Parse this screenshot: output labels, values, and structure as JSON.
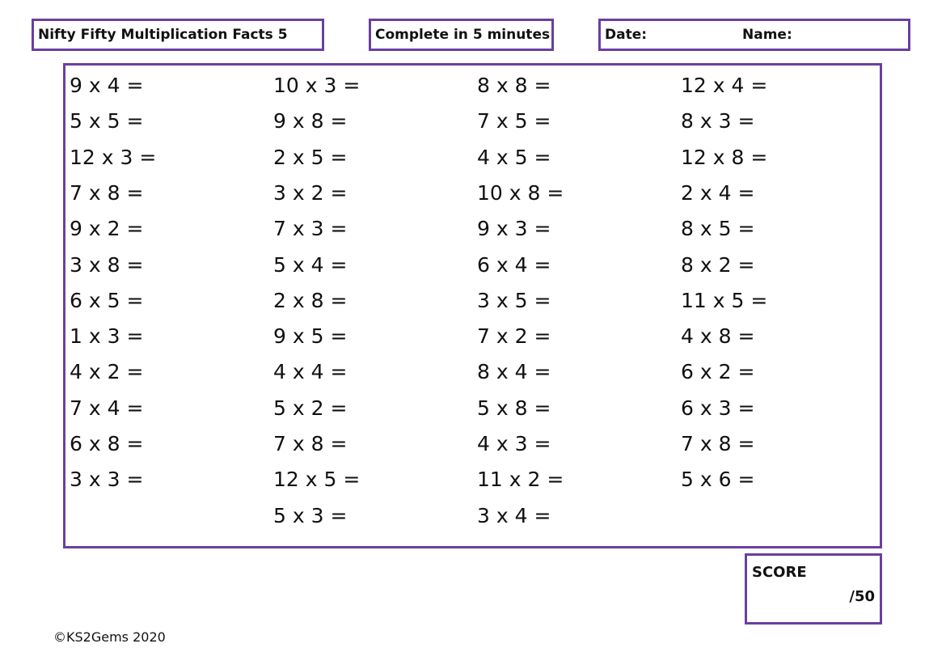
{
  "header": {
    "title": "Nifty Fifty Multiplication Facts 5",
    "time_limit": "Complete in 5 minutes",
    "date_label": "Date:",
    "name_label": "Name:"
  },
  "columns": [
    [
      "9 x 4 =",
      "5 x 5 =",
      "12 x 3 =",
      "7 x 8 =",
      "9 x 2 =",
      "3 x 8 =",
      "6 x 5 =",
      "1 x 3 =",
      "4 x 2 =",
      "7 x 4 =",
      "6 x 8 =",
      "3 x 3 ="
    ],
    [
      "10 x 3 =",
      "9 x 8 =",
      "2 x 5 =",
      "3 x 2 =",
      "7 x 3 =",
      "5 x 4 =",
      "2 x 8 =",
      "9 x 5 =",
      "4 x 4 =",
      "5 x 2 =",
      "7 x 8 =",
      "12 x 5 =",
      "5 x 3 ="
    ],
    [
      "8 x 8 =",
      "7 x 5 =",
      "4 x 5 =",
      "10 x 8 =",
      "9 x 3 =",
      "6 x 4 =",
      "3 x 5 =",
      "7 x 2 =",
      "8 x 4 =",
      "5 x 8 =",
      "4 x 3 =",
      "11 x 2 =",
      "3 x 4 ="
    ],
    [
      "12 x 4 =",
      "8 x 3 =",
      "12 x 8 =",
      "2 x 4 =",
      "8 x 5 =",
      "8 x 2 =",
      "11 x 5 =",
      "4 x 8 =",
      "6 x 2 =",
      "6 x 3 =",
      "7 x 8 =",
      "5 x 6 ="
    ]
  ],
  "score": {
    "label": "SCORE",
    "total": "/50"
  },
  "footer": {
    "copyright": "©KS2Gems 2020"
  },
  "colors": {
    "border": "#6b3fa0"
  }
}
